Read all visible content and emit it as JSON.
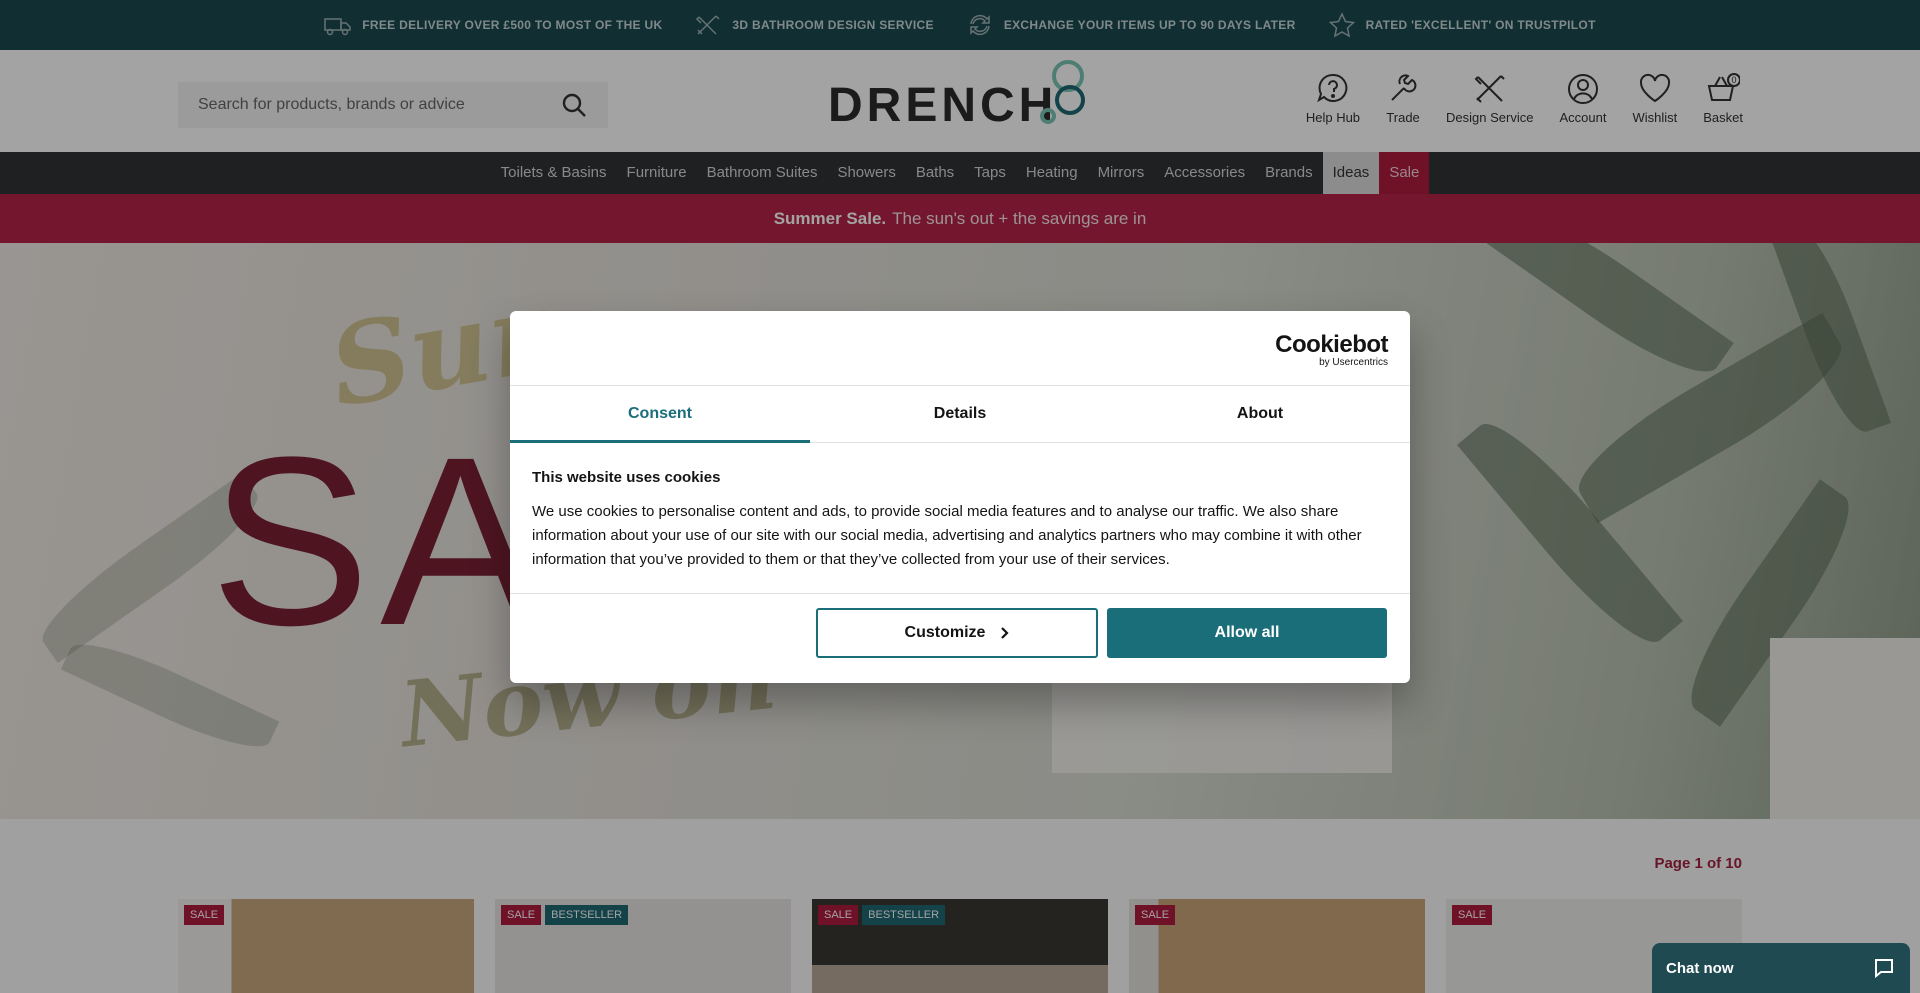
{
  "promo_bar": {
    "items": [
      {
        "icon": "delivery-truck-icon",
        "text": "FREE DELIVERY OVER £500 TO MOST OF THE UK"
      },
      {
        "icon": "design-tools-icon",
        "text": "3D BATHROOM DESIGN SERVICE"
      },
      {
        "icon": "exchange-arrows-icon",
        "text": "EXCHANGE YOUR ITEMS UP TO 90 DAYS LATER"
      },
      {
        "icon": "star-icon",
        "text": "RATED 'EXCELLENT' ON TRUSTPILOT"
      }
    ]
  },
  "header": {
    "search_placeholder": "Search for products, brands or advice",
    "logo": "DRENCH",
    "icons": [
      {
        "label": "Help Hub",
        "icon": "help-icon"
      },
      {
        "label": "Trade",
        "icon": "wrench-icon"
      },
      {
        "label": "Design Service",
        "icon": "design-tools-icon"
      },
      {
        "label": "Account",
        "icon": "account-icon"
      },
      {
        "label": "Wishlist",
        "icon": "heart-icon"
      },
      {
        "label": "Basket",
        "icon": "basket-icon",
        "count": "0"
      }
    ]
  },
  "nav": {
    "items": [
      "Toilets & Basins",
      "Furniture",
      "Bathroom Suites",
      "Showers",
      "Baths",
      "Taps",
      "Heating",
      "Mirrors",
      "Accessories",
      "Brands",
      "Ideas",
      "Sale"
    ]
  },
  "sale_strip": {
    "bold": "Summer Sale.",
    "text": "The sun's out + the savings are in"
  },
  "hero": {
    "line1": "Sun",
    "line2": "SA",
    "line3": "Now on"
  },
  "products": {
    "page_indicator": "Page 1 of 10",
    "cards": [
      {
        "badges": [
          "SALE"
        ]
      },
      {
        "badges": [
          "SALE",
          "BESTSELLER"
        ]
      },
      {
        "badges": [
          "SALE",
          "BESTSELLER"
        ]
      },
      {
        "badges": [
          "SALE"
        ]
      },
      {
        "badges": [
          "SALE"
        ]
      }
    ]
  },
  "cookie": {
    "brand": "Cookiebot",
    "brand_sub": "by Usercentrics",
    "tabs": [
      "Consent",
      "Details",
      "About"
    ],
    "active_tab": "Consent",
    "heading": "This website uses cookies",
    "text": "We use cookies to personalise content and ads, to provide social media features and to analyse our traffic. We also share information about your use of our site with our social media, advertising and analytics partners who may combine it with other information that you’ve provided to them or that they’ve collected from your use of their services.",
    "customize_label": "Customize",
    "allow_label": "Allow all"
  },
  "chat": {
    "label": "Chat now",
    "icon": "chat-bubble-icon"
  },
  "colors": {
    "promo_bg": "#1b4a50",
    "nav_bg": "#2f3335",
    "sale_red": "#b8234a",
    "cookie_accent": "#1a6e7a"
  }
}
